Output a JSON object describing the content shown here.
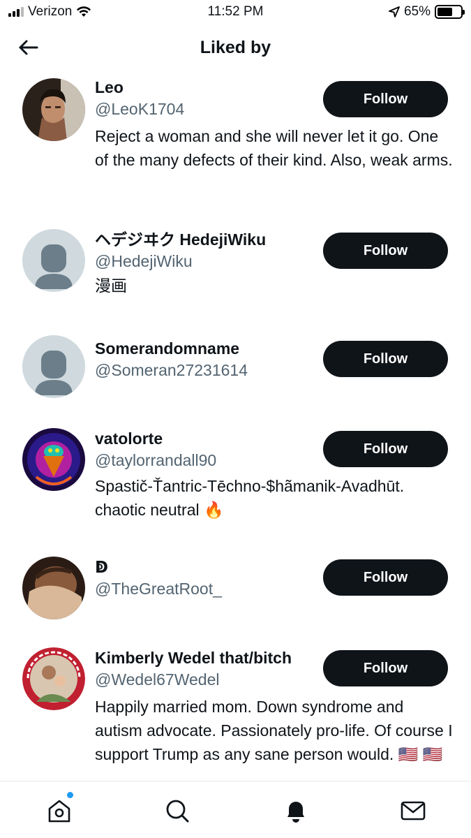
{
  "status_bar": {
    "carrier": "Verizon",
    "time": "11:52 PM",
    "battery": "65%",
    "battery_level": 0.65
  },
  "header": {
    "title": "Liked by"
  },
  "users": [
    {
      "name": "Leo",
      "handle": "@LeoK1704",
      "bio": "Reject a woman and she will never let it go. One of the many defects of their kind. Also, weak arms.",
      "follow_label": "Follow",
      "avatar": "photo"
    },
    {
      "name": "ヘデジヰク HedejiWiku",
      "handle": "@HedejiWiku",
      "bio": "漫画",
      "follow_label": "Follow",
      "avatar": "default-person-icon"
    },
    {
      "name": "Somerandomname",
      "handle": "@Someran27231614",
      "bio": "",
      "follow_label": "Follow",
      "avatar": "default-person-icon"
    },
    {
      "name": "vatolorte",
      "handle": "@taylorrandall90",
      "bio": "Spastič-Ťantric-Tēchno-$hãmanik-Avadhūt. chaotic neutral 🔥",
      "follow_label": "Follow",
      "avatar": "psychedelic-art"
    },
    {
      "name": "ↁ",
      "handle": "@TheGreatRoot_",
      "bio": "",
      "follow_label": "Follow",
      "avatar": "painting"
    },
    {
      "name": "Kimberly Wedel that/bitch",
      "handle": "@Wedel67Wedel",
      "bio": "Happily married mom. Down syndrome and autism advocate. Passionately pro-life. Of course I support Trump as any sane person would. 🇺🇸 🇺🇸",
      "follow_label": "Follow",
      "avatar": "photo-with-badge",
      "avatar_badge_text": "PRO SCIENCE · PRO WOMAN · PRO LIFE"
    }
  ],
  "bottom_nav": {
    "items": [
      "home-icon",
      "search-icon",
      "notifications-icon",
      "messages-icon"
    ],
    "has_unread_home": true
  },
  "colors": {
    "primary_text": "#0f1419",
    "secondary_text": "#536471",
    "button_bg": "#0f1419",
    "accent_blue": "#1d9bf0",
    "placeholder_avatar_bg": "#cfd9de",
    "placeholder_avatar_fg": "#6b7e8a"
  }
}
